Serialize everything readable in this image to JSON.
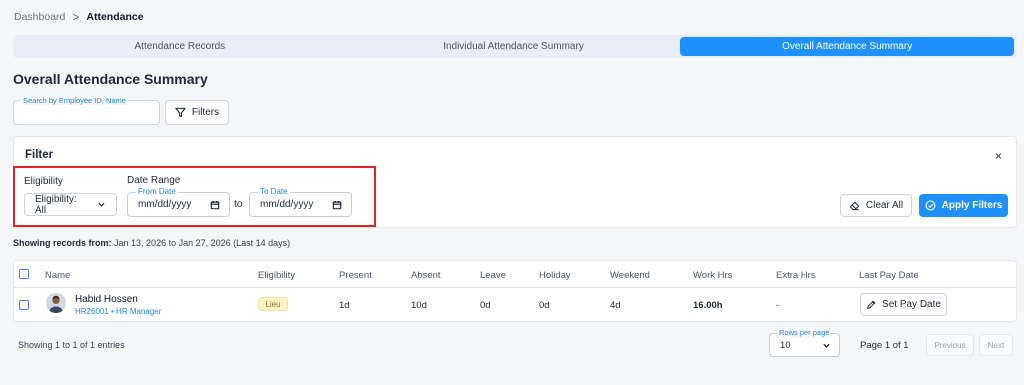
{
  "breadcrumb": {
    "root": "Dashboard",
    "separator": ">",
    "current": "Attendance"
  },
  "tabs": [
    {
      "label": "Attendance Records",
      "active": false
    },
    {
      "label": "Individual Attendance Summary",
      "active": false
    },
    {
      "label": "Overall Attendance Summary",
      "active": true
    }
  ],
  "page_title": "Overall Attendance Summary",
  "search": {
    "label": "Search by Employee ID, Name",
    "value": ""
  },
  "filters_button": {
    "label": "Filters",
    "icon": "filter-icon"
  },
  "filter_panel": {
    "title": "Filter",
    "close_symbol": "×",
    "eligibility": {
      "label": "Eligibility",
      "selected": "Eligibility: All"
    },
    "date_range": {
      "label": "Date Range",
      "from": {
        "label": "From Date",
        "placeholder": "mm/dd/yyyy"
      },
      "to_text": "to",
      "to": {
        "label": "To Date",
        "placeholder": "mm/dd/yyyy"
      }
    },
    "clear_all_label": "Clear All",
    "apply_label": "Apply Filters"
  },
  "showing": {
    "prefix": "Showing records from:",
    "range": "Jan 13, 2026 to Jan 27, 2026 (Last 14 days)"
  },
  "table": {
    "columns": [
      "Name",
      "Eligibility",
      "Present",
      "Absent",
      "Leave",
      "Holiday",
      "Weekend",
      "Work Hrs",
      "Extra Hrs",
      "Last Pay Date"
    ],
    "rows": [
      {
        "name": "Habid Hossen",
        "meta": "HR26001 • HR Manager",
        "eligibility": "Lieu",
        "present": "1d",
        "absent": "10d",
        "leave": "0d",
        "holiday": "0d",
        "weekend": "4d",
        "work_hrs": "16.00h",
        "extra_hrs": "-",
        "action_label": "Set Pay Date"
      }
    ]
  },
  "footer": {
    "entries": "Showing 1 to 1 of 1 entries",
    "rows_per_page_label": "Rows per page",
    "rows_per_page_value": "10",
    "page_info": "Page 1 of 1",
    "previous_label": "Previous",
    "next_label": "Next"
  },
  "colors": {
    "accent": "#1e90ff",
    "highlight": "#e02424",
    "badge_bg": "#fdf3c7"
  }
}
